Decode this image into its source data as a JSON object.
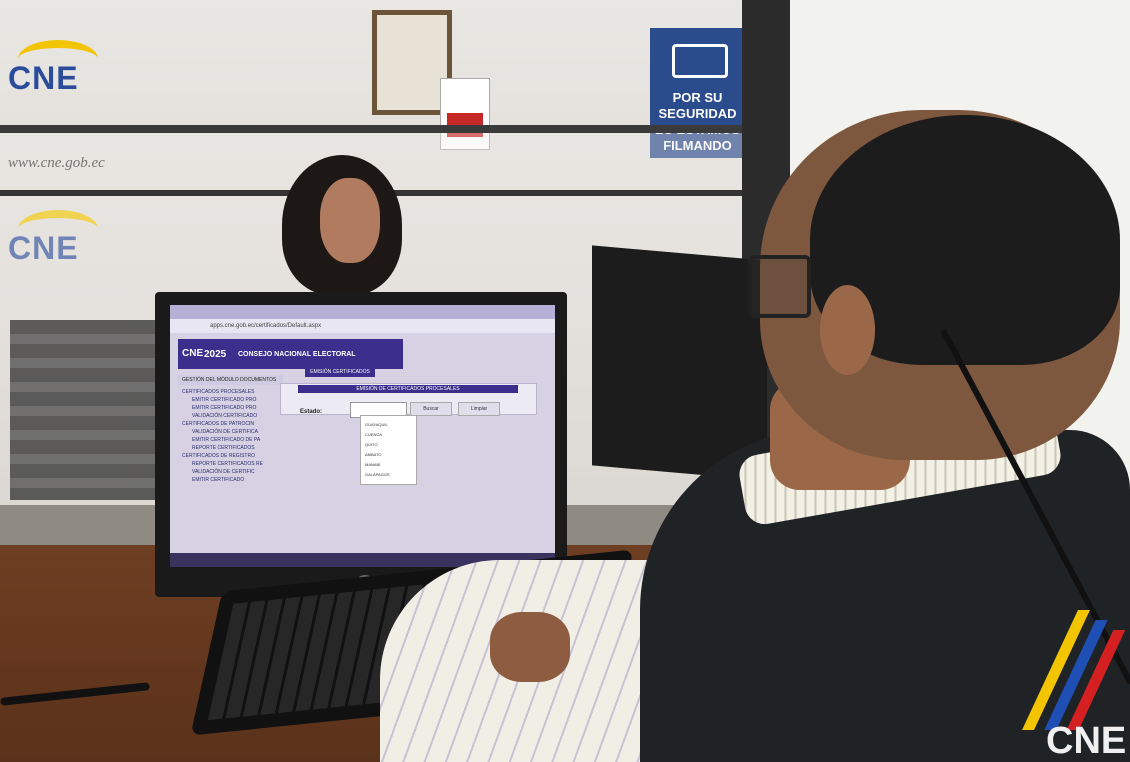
{
  "scene": {
    "wall_logo_1": "CNE",
    "wall_logo_2": "CNE",
    "website": "www.cne.gob.ec",
    "sign_text": "POR SU SEGURIDAD LO ESTAMOS FILMANDO"
  },
  "screen": {
    "address_bar": "apps.cne.gob.ec/certificados/Default.aspx",
    "banner": {
      "brand": "CNE",
      "year": "2025",
      "org": "CONSEJO NACIONAL ELECTORAL"
    },
    "nav_tab": "EMISIÓN CERTIFICADOS",
    "sidebar_header": "GESTIÓN DEL MÓDULO DOCUMENTOS",
    "sidebar_items": [
      "CERTIFICADOS PROCESALES",
      "EMITIR CERTIFICADO PRO",
      "EMITIR CERTIFICADO PRO",
      "VALIDACIÓN CERTIFICADO",
      "CERTIFICADOS DE PATROCIN",
      "VALIDACIÓN DE CERTIFICA",
      "EMITIR CERTIFICADO DE PA",
      "REPORTE CERTIFICADOS",
      "CERTIFICADOS DE REGISTRO",
      "REPORTE CERTIFICADOS RE",
      "VALIDACIÓN DE CERTIFIC",
      "EMITIR CERTIFICADO"
    ],
    "panel_title": "EMISIÓN DE CERTIFICADOS PROCESALES",
    "field_label": "Estado:",
    "buttons": [
      "Buscar",
      "Limpiar"
    ],
    "dropdown_options": [
      "GUAYAQUIL",
      "CUENCA",
      "QUITO",
      "AMBATO",
      "MANABÍ",
      "GALÁPAGOS"
    ]
  },
  "colors": {
    "cne_blue": "#2b4c9a",
    "cne_yellow": "#f2c500",
    "screen_accent": "#3b2e8c"
  }
}
